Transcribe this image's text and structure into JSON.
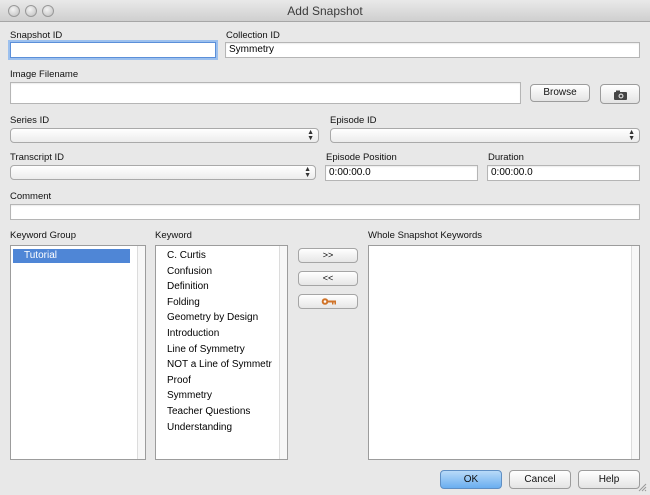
{
  "window": {
    "title": "Add Snapshot"
  },
  "snapshot_id": {
    "label": "Snapshot ID",
    "value": ""
  },
  "collection_id": {
    "label": "Collection ID",
    "value": "Symmetry"
  },
  "image_filename": {
    "label": "Image Filename",
    "value": ""
  },
  "buttons": {
    "browse": "Browse",
    "ok": "OK",
    "cancel": "Cancel",
    "help": "Help"
  },
  "icons": {
    "camera": "camera-icon",
    "keyword_tag": "key-icon"
  },
  "series_id": {
    "label": "Series ID",
    "value": ""
  },
  "episode_id": {
    "label": "Episode ID",
    "value": ""
  },
  "transcript_id": {
    "label": "Transcript ID",
    "value": ""
  },
  "episode_position": {
    "label": "Episode Position",
    "value": "0:00:00.0"
  },
  "duration": {
    "label": "Duration",
    "value": "0:00:00.0"
  },
  "comment": {
    "label": "Comment",
    "value": ""
  },
  "keyword_group": {
    "label": "Keyword Group",
    "items": [
      "Tutorial"
    ],
    "selected": "Tutorial"
  },
  "keyword": {
    "label": "Keyword",
    "items": [
      "C. Curtis",
      "Confusion",
      "Definition",
      "Folding",
      "Geometry by Design",
      "Introduction",
      "Line of Symmetry",
      "NOT a Line of Symmetr",
      "Proof",
      "Symmetry",
      "Teacher Questions",
      "Understanding"
    ]
  },
  "whole_snapshot_keywords": {
    "label": "Whole Snapshot Keywords",
    "items": []
  },
  "transfer": {
    "add": ">>",
    "remove": "<<"
  },
  "colors": {
    "accent": "#4f86d6",
    "default_button": "#6aaef0"
  }
}
